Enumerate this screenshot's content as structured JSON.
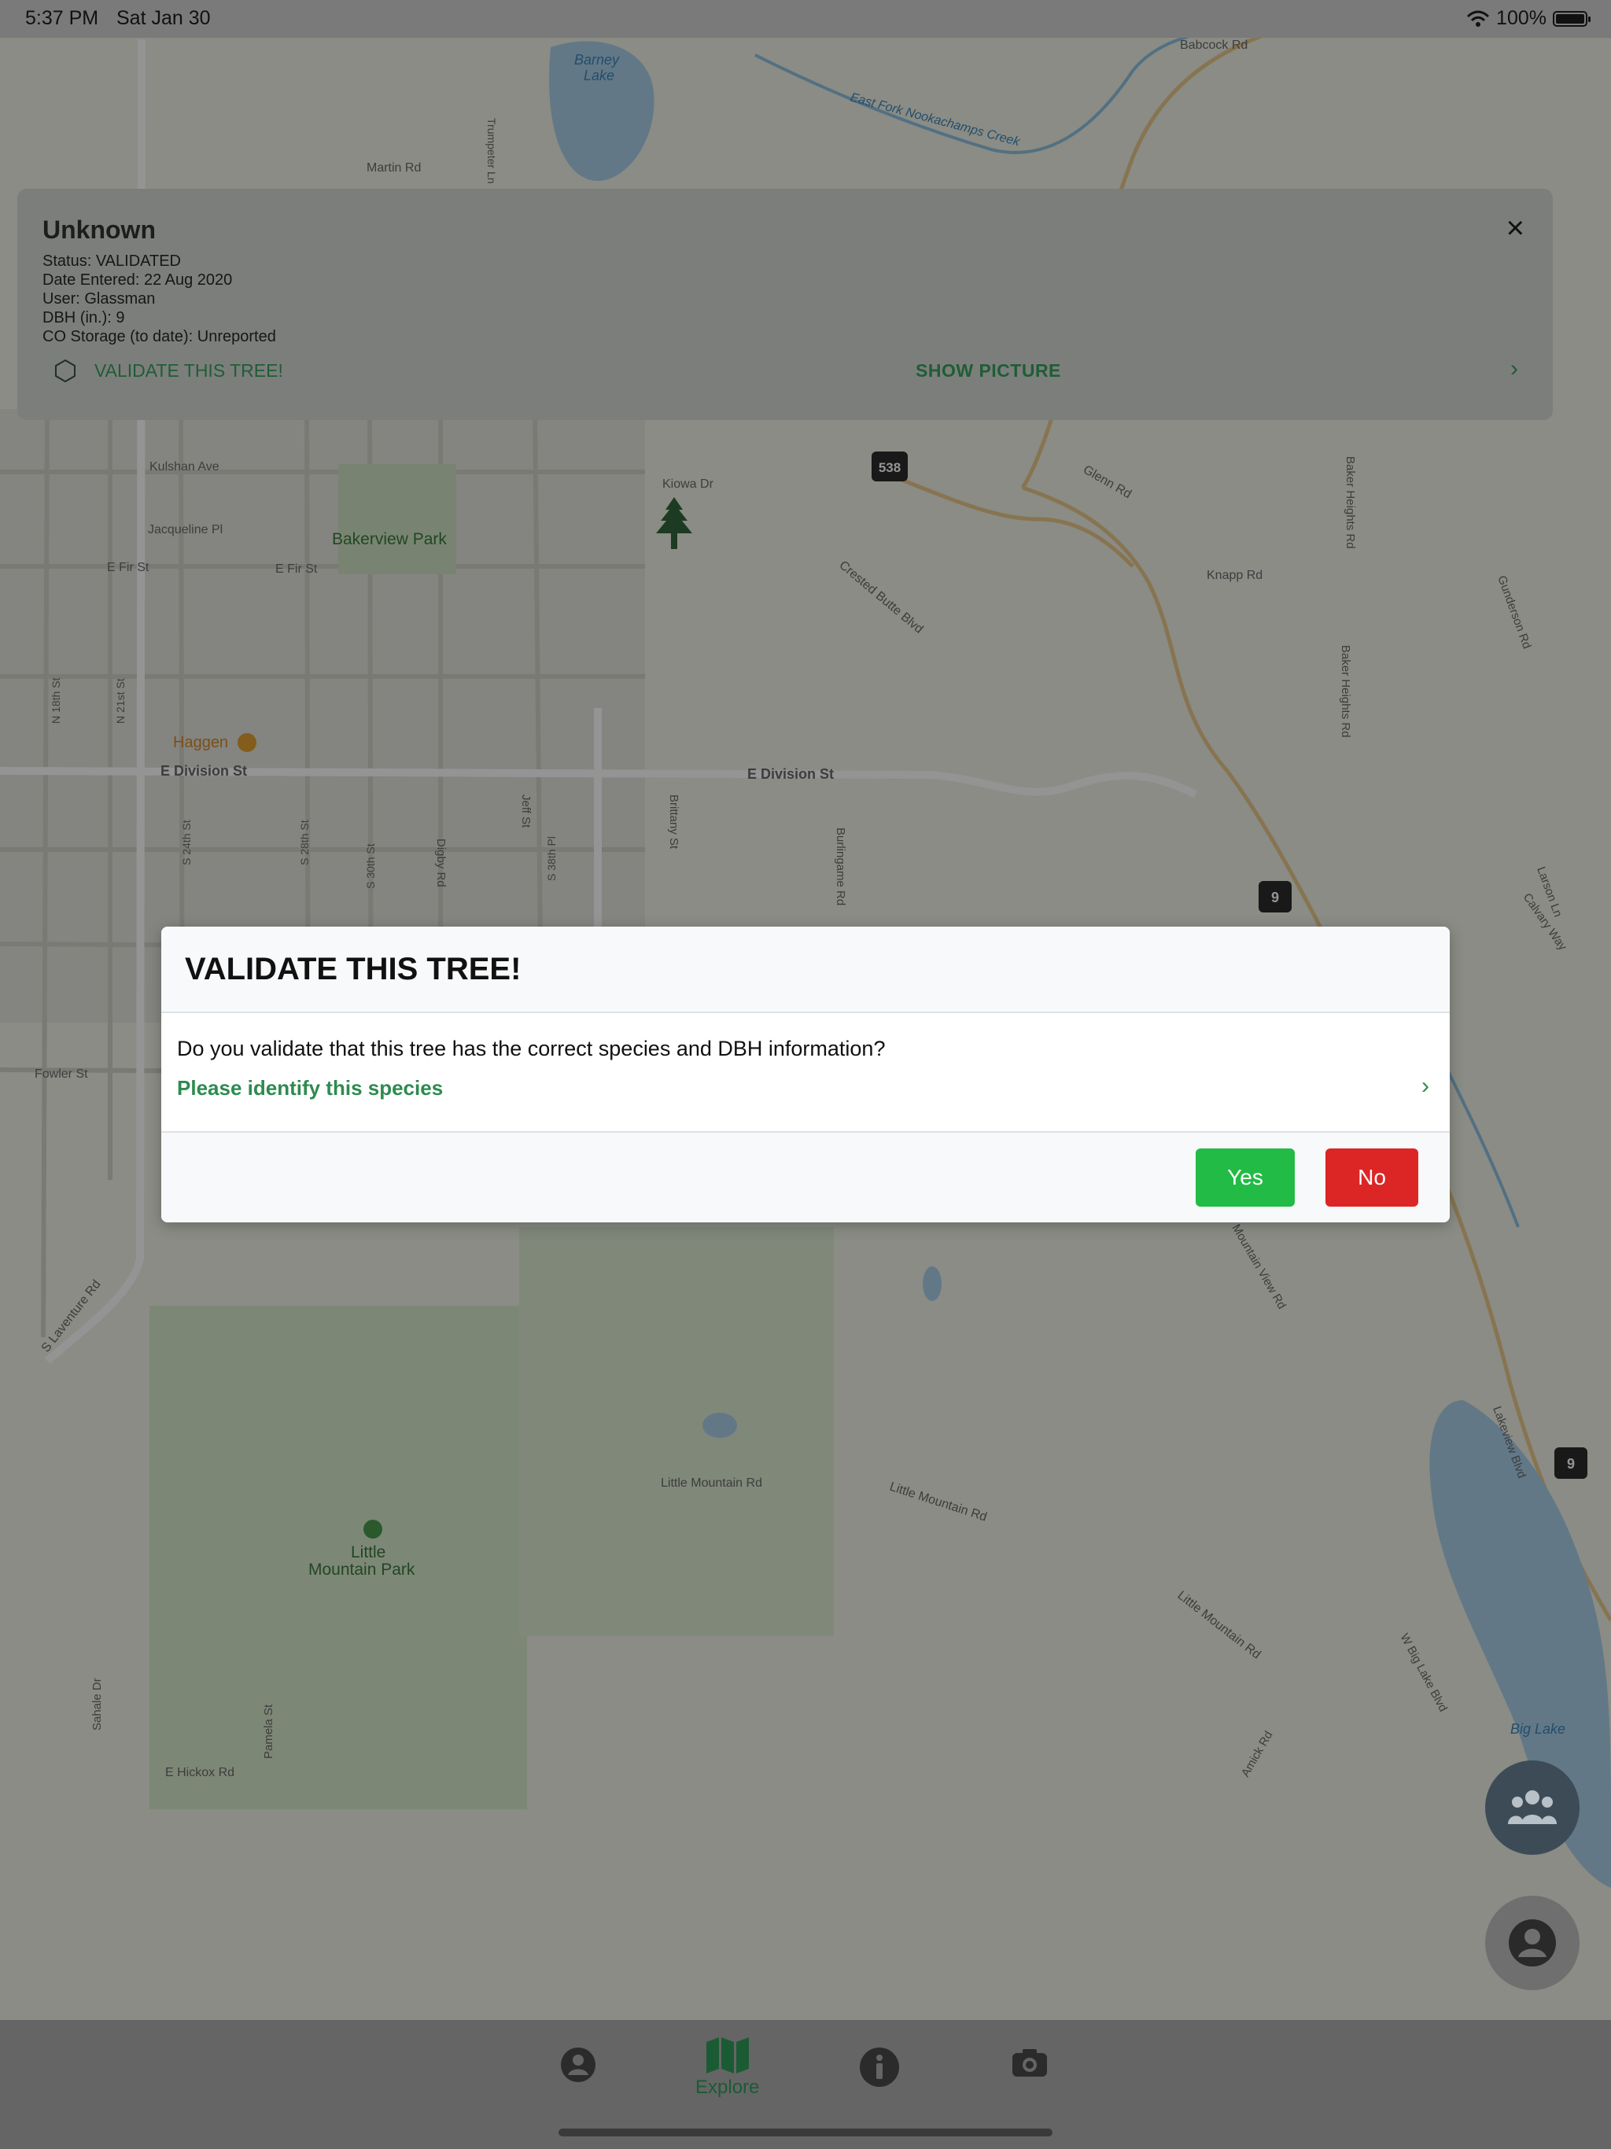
{
  "status_bar": {
    "time": "5:37 PM",
    "date": "Sat Jan 30",
    "battery": "100%"
  },
  "map": {
    "labels": {
      "barney_lake": [
        "Barney",
        "Lake"
      ],
      "east_fork": "East Fork Nookachamps Creek",
      "nookachamps": "Nookachamps Creek",
      "babcock": "Babcock Rd",
      "martin": "Martin Rd",
      "trumpeter": "Trumpeter Ln",
      "kulshan": "Kulshan Ave",
      "jacqueline": "Jacqueline Pl",
      "e_fir": "E Fir St",
      "e_fir2": "E Fir St",
      "bakerview": "Bakerview Park",
      "kiowa": "Kiowa Dr",
      "crested": "Crested Butte Blvd",
      "glenn": "Glenn Rd",
      "knapp": "Knapp Rd",
      "baker_heights": "Baker Heights Rd",
      "baker_heights2": "Baker Heights Rd",
      "gunderson": "Gunderson Rd",
      "haggen": "Haggen",
      "e_division": "E Division St",
      "e_division2": "E Division St",
      "burlingame": "Burlingame Rd",
      "brittany": "Brittany St",
      "jeff": "Jeff St",
      "digby": "Digby Rd",
      "fowler": "Fowler St",
      "s_laventure": "S Laventure Rd",
      "little_mtn_rd": "Little Mountain Rd",
      "little_mtn_rd2": "Little Mountain Rd",
      "little_mtn_rd3": "Little Mountain Rd",
      "little_mtn_park": [
        "Little",
        "Mountain Park"
      ],
      "e_hickox": "E Hickox Rd",
      "big_lake": "Big Lake",
      "w_big_lake": "W Big Lake Blvd",
      "lakeview": "Lakeview Blvd",
      "calvary": "Calvary Way",
      "larson": "Larson Ln",
      "n_18th": "N 18th St",
      "n_21st": "N 21st St",
      "s_24th": "S 24th St",
      "s_28th": "S 28th St",
      "s_30th": "S 30th St",
      "s_38th": "S 38th Pl",
      "route_538": "538",
      "route_9a": "9",
      "route_9b": "9",
      "mountain_view": "Mountain View Rd",
      "amick": "Amick Rd",
      "pamela": "Pamela St",
      "sahale": "Sahale Dr"
    }
  },
  "tree_card": {
    "title": "Unknown",
    "status": "Status: VALIDATED",
    "date_entered": "Date Entered: 22 Aug 2020",
    "user": "User: Glassman",
    "dbh": "DBH (in.): 9",
    "co_storage": "CO Storage (to date): Unreported",
    "validate_label": "VALIDATE THIS TREE!",
    "show_picture": "SHOW PICTURE",
    "close_icon": "×",
    "chevron": "›"
  },
  "modal": {
    "title": "VALIDATE THIS TREE!",
    "question": "Do you validate that this tree has the correct species and DBH information?",
    "identify_link": "Please identify this species",
    "chevron": "›",
    "yes_label": "Yes",
    "no_label": "No",
    "colors": {
      "yes": "#22bb45",
      "no": "#dc2626",
      "link": "#2e8b4f"
    }
  },
  "fabs": {
    "group_icon": "group-icon",
    "profile_icon": "user-circle-icon"
  },
  "tab_bar": {
    "tabs": [
      {
        "icon": "user-circle-icon",
        "label": ""
      },
      {
        "icon": "map-icon",
        "label": "Explore"
      },
      {
        "icon": "info-circle-icon",
        "label": ""
      },
      {
        "icon": "camera-icon",
        "label": ""
      }
    ]
  }
}
